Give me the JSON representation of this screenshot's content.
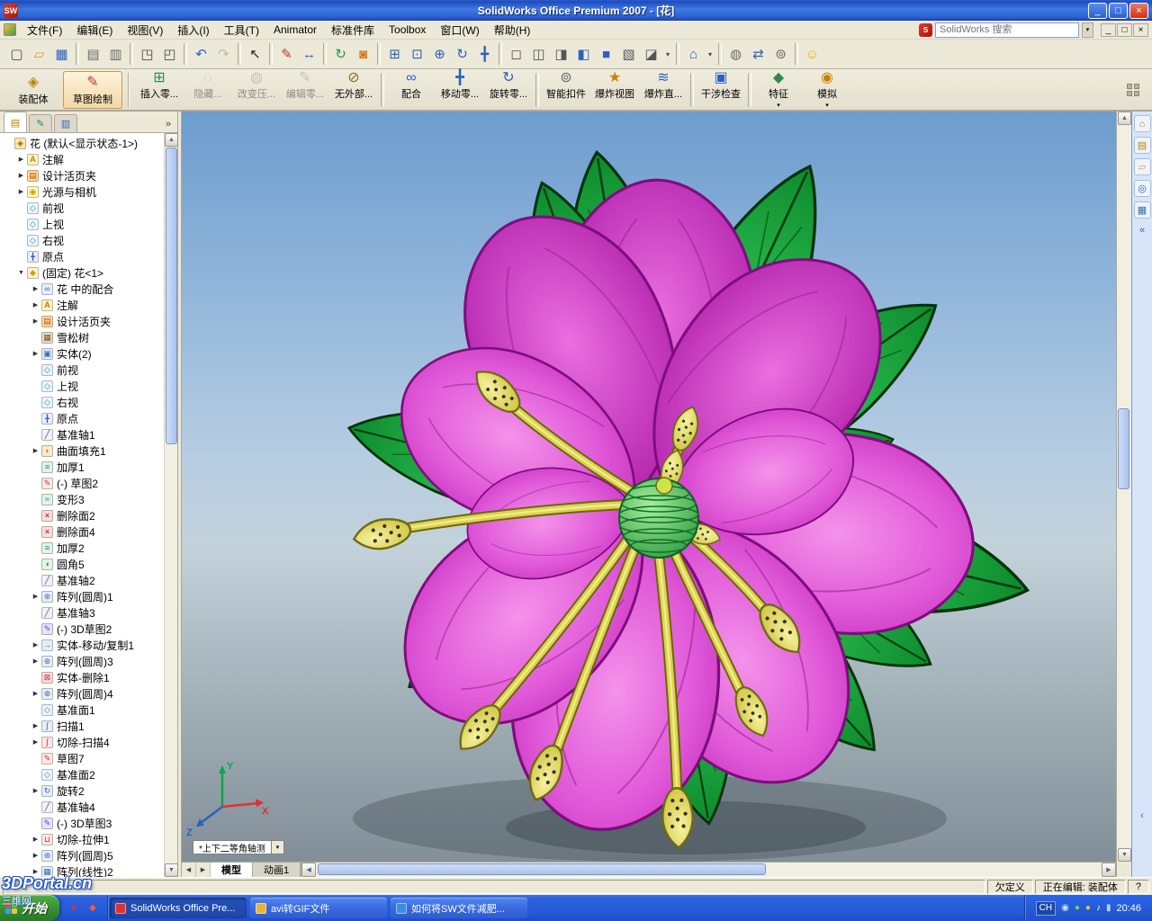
{
  "titlebar": {
    "title": "SolidWorks Office Premium 2007 - [花]",
    "buttons": {
      "minimize": "_",
      "restore": "□",
      "close": "×"
    }
  },
  "menubar": {
    "items": [
      "文件(F)",
      "编辑(E)",
      "视图(V)",
      "插入(I)",
      "工具(T)",
      "Animator",
      "标准件库",
      "Toolbox",
      "窗口(W)",
      "帮助(H)"
    ],
    "search": {
      "placeholder": "SolidWorks 搜索"
    },
    "child_buttons": {
      "minimize": "_",
      "restore": "□",
      "close": "×"
    }
  },
  "toolbar": {
    "items": [
      {
        "name": "new-document",
        "glyph": "▢",
        "color": "#4a4a4a",
        "type": "btn"
      },
      {
        "name": "open-document",
        "glyph": "▱",
        "color": "#d79b2a",
        "type": "btn"
      },
      {
        "name": "save-document",
        "glyph": "▦",
        "color": "#2a62bd",
        "type": "btn"
      },
      {
        "type": "sep",
        "inter": false
      },
      {
        "name": "make-drawing-from-part",
        "glyph": "▤",
        "color": "#6a6a6a",
        "type": "btn"
      },
      {
        "name": "make-assembly-from-part",
        "glyph": "▥",
        "color": "#6a6a6a",
        "type": "btn"
      },
      {
        "type": "sep",
        "inter": false
      },
      {
        "name": "print",
        "glyph": "◳",
        "color": "#4a4a4a",
        "type": "btn"
      },
      {
        "name": "print-preview",
        "glyph": "◰",
        "color": "#4a4a4a",
        "type": "btn"
      },
      {
        "type": "sep",
        "inter": false
      },
      {
        "name": "undo",
        "glyph": "↶",
        "color": "#2a62bd",
        "type": "btn"
      },
      {
        "name": "redo",
        "glyph": "↷",
        "color": "#777777",
        "type": "btn grayed"
      },
      {
        "type": "sep",
        "inter": false
      },
      {
        "name": "select",
        "glyph": "↖",
        "color": "#222222",
        "type": "btn"
      },
      {
        "type": "sep",
        "inter": false
      },
      {
        "name": "sketch",
        "glyph": "✎",
        "color": "#c0392b",
        "type": "btn"
      },
      {
        "name": "smart-dimension",
        "glyph": "↔",
        "color": "#2a62bd",
        "type": "btn"
      },
      {
        "type": "sep",
        "inter": false
      },
      {
        "name": "rebuild",
        "glyph": "↻",
        "color": "#2e8b57",
        "type": "btn"
      },
      {
        "name": "edit-appearance",
        "glyph": "◙",
        "color": "#d07818",
        "type": "btn"
      },
      {
        "type": "sep",
        "inter": false
      },
      {
        "name": "zoom-to-fit",
        "glyph": "⊞",
        "color": "#2a62bd",
        "type": "btn"
      },
      {
        "name": "zoom-to-area",
        "glyph": "⊡",
        "color": "#2a62bd",
        "type": "btn"
      },
      {
        "name": "zoom-in-out",
        "glyph": "⊕",
        "color": "#2a62bd",
        "type": "btn"
      },
      {
        "name": "rotate-view",
        "glyph": "↻",
        "color": "#2a62bd",
        "type": "btn"
      },
      {
        "name": "pan",
        "glyph": "╋",
        "color": "#2a62bd",
        "type": "btn"
      },
      {
        "type": "sep",
        "inter": false
      },
      {
        "name": "wireframe",
        "glyph": "◻",
        "color": "#555555",
        "type": "btn"
      },
      {
        "name": "hidden-lines-visible",
        "glyph": "◫",
        "color": "#555555",
        "type": "btn"
      },
      {
        "name": "hidden-lines-removed",
        "glyph": "◨",
        "color": "#555555",
        "type": "btn"
      },
      {
        "name": "shaded-with-edges",
        "glyph": "◧",
        "color": "#2a62bd",
        "type": "btn"
      },
      {
        "name": "shaded",
        "glyph": "■",
        "color": "#2a62bd",
        "type": "btn"
      },
      {
        "name": "shadows-in-shaded-mode",
        "glyph": "▧",
        "color": "#555555",
        "type": "btn"
      },
      {
        "name": "section-view",
        "glyph": "◪",
        "color": "#555555",
        "type": "btn"
      },
      {
        "name": "view-settings-dropdown",
        "glyph": "▾",
        "color": "#444444",
        "type": "dd"
      },
      {
        "type": "sep",
        "inter": false
      },
      {
        "name": "standard-views",
        "glyph": "⌂",
        "color": "#2a62bd",
        "type": "btn"
      },
      {
        "name": "standard-views-dropdown",
        "glyph": "▾",
        "color": "#444444",
        "type": "dd"
      },
      {
        "type": "sep",
        "inter": false
      },
      {
        "name": "hide-show-components",
        "glyph": "◍",
        "color": "#6a6a6a",
        "type": "btn"
      },
      {
        "name": "move-component-tool",
        "glyph": "⇄",
        "color": "#2a62bd",
        "type": "btn"
      },
      {
        "name": "smart-fasteners-tool",
        "glyph": "⊚",
        "color": "#6a6a6a",
        "type": "btn"
      },
      {
        "type": "sep",
        "inter": false
      },
      {
        "name": "realview-graphics",
        "glyph": "☺",
        "color": "#e8b800",
        "type": "btn"
      }
    ]
  },
  "command_manager": {
    "tabs": [
      {
        "name": "assembly",
        "label": "装配体",
        "glyph": "◈",
        "color": "#b58600",
        "state": "tab"
      },
      {
        "name": "sketch-mode",
        "label": "草图绘制",
        "glyph": "✎",
        "color": "#c0392b",
        "state": "tab active"
      }
    ],
    "buttons": [
      {
        "name": "insert-component",
        "glyph": "⊞",
        "color": "#2e8b57",
        "label": "插入零...",
        "state": "btn"
      },
      {
        "name": "hide-show-component",
        "glyph": "◌",
        "color": "#888888",
        "label": "隐藏...",
        "state": "btn grayed"
      },
      {
        "name": "change-suppression",
        "glyph": "◍",
        "color": "#888888",
        "label": "改变压...",
        "state": "btn grayed"
      },
      {
        "name": "edit-component",
        "glyph": "✎",
        "color": "#888888",
        "label": "编辑零...",
        "state": "btn grayed"
      },
      {
        "name": "no-external-references",
        "glyph": "⊘",
        "color": "#8a6d1d",
        "label": "无外部...",
        "state": "btn"
      },
      {
        "state": "sep",
        "inter": false
      },
      {
        "name": "mate",
        "glyph": "∞",
        "color": "#2a62bd",
        "label": "配合",
        "state": "btn"
      },
      {
        "name": "move-component",
        "glyph": "╋",
        "color": "#2a62bd",
        "label": "移动零...",
        "state": "btn"
      },
      {
        "name": "rotate-component",
        "glyph": "↻",
        "color": "#2a62bd",
        "label": "旋转零...",
        "state": "btn"
      },
      {
        "state": "sep",
        "inter": false
      },
      {
        "name": "smart-fasteners",
        "glyph": "⊚",
        "color": "#6a6a6a",
        "label": "智能扣件",
        "state": "btn"
      },
      {
        "name": "exploded-view",
        "glyph": "★",
        "color": "#d08000",
        "label": "爆炸视图",
        "state": "btn"
      },
      {
        "name": "explode-line-sketch",
        "glyph": "≋",
        "color": "#2a62bd",
        "label": "爆炸直...",
        "state": "btn"
      },
      {
        "state": "sep",
        "inter": false
      },
      {
        "name": "interference-detection",
        "glyph": "▣",
        "color": "#2a62bd",
        "label": "干涉检查",
        "state": "btn"
      },
      {
        "state": "sep",
        "inter": false
      },
      {
        "name": "features-flyout",
        "glyph": "◆",
        "color": "#2e8b57",
        "label": "特征",
        "state": "btn",
        "dropdown": true
      },
      {
        "name": "simulation-flyout",
        "glyph": "◉",
        "color": "#d08000",
        "label": "模拟",
        "state": "btn",
        "dropdown": true
      }
    ]
  },
  "feature_panel": {
    "tabs": [
      {
        "name": "featuremanager-tab",
        "glyph": "▤",
        "color": "#b58600",
        "state": "ptab active"
      },
      {
        "name": "propertymanager-tab",
        "glyph": "✎",
        "color": "#2e8b57",
        "state": "ptab"
      },
      {
        "name": "configurationmanager-tab",
        "glyph": "▥",
        "color": "#2a62bd",
        "state": "ptab"
      }
    ]
  },
  "feature_tree": {
    "items": [
      {
        "label": "花 (默认<显示状态-1>)",
        "icon": "assembly",
        "ind": "ind0",
        "arrow": null
      },
      {
        "label": "注解",
        "icon": "annotations",
        "ind": "ind1",
        "arrow": "right"
      },
      {
        "label": "设计活页夹",
        "icon": "design-binder",
        "ind": "ind1",
        "arrow": "right"
      },
      {
        "label": "光源与相机",
        "icon": "lights-cameras",
        "ind": "ind1",
        "arrow": "right"
      },
      {
        "label": "前视",
        "icon": "plane",
        "ind": "ind1",
        "arrow": null
      },
      {
        "label": "上视",
        "icon": "plane",
        "ind": "ind1",
        "arrow": null
      },
      {
        "label": "右视",
        "icon": "plane",
        "ind": "ind1",
        "arrow": null
      },
      {
        "label": "原点",
        "icon": "origin",
        "ind": "ind1",
        "arrow": null
      },
      {
        "label": "(固定) 花<1>",
        "icon": "part",
        "ind": "ind1",
        "arrow": "down"
      },
      {
        "label": "花 中的配合",
        "icon": "mates",
        "ind": "ind2",
        "arrow": "right"
      },
      {
        "label": "注解",
        "icon": "annotations",
        "ind": "ind2",
        "arrow": "right"
      },
      {
        "label": "设计活页夹",
        "icon": "design-binder",
        "ind": "ind2",
        "arrow": "right"
      },
      {
        "label": "雪松树",
        "icon": "material",
        "ind": "ind2",
        "arrow": null
      },
      {
        "label": "实体(2)",
        "icon": "solid-bodies",
        "ind": "ind2",
        "arrow": "right"
      },
      {
        "label": "前视",
        "icon": "plane",
        "ind": "ind2",
        "arrow": null
      },
      {
        "label": "上视",
        "icon": "plane",
        "ind": "ind2",
        "arrow": null
      },
      {
        "label": "右视",
        "icon": "plane",
        "ind": "ind2",
        "arrow": null
      },
      {
        "label": "原点",
        "icon": "origin",
        "ind": "ind2",
        "arrow": null
      },
      {
        "label": "基准轴1",
        "icon": "axis",
        "ind": "ind2",
        "arrow": null
      },
      {
        "label": "曲面填充1",
        "icon": "surface-fill",
        "ind": "ind2",
        "arrow": "right"
      },
      {
        "label": "加厚1",
        "icon": "thicken",
        "ind": "ind2",
        "arrow": null
      },
      {
        "label": "(-) 草图2",
        "icon": "sketch",
        "ind": "ind2",
        "arrow": null
      },
      {
        "label": "变形3",
        "icon": "deform",
        "ind": "ind2",
        "arrow": null
      },
      {
        "label": "删除面2",
        "icon": "delete-face",
        "ind": "ind2",
        "arrow": null
      },
      {
        "label": "删除面4",
        "icon": "delete-face",
        "ind": "ind2",
        "arrow": null
      },
      {
        "label": "加厚2",
        "icon": "thicken",
        "ind": "ind2",
        "arrow": null
      },
      {
        "label": "圆角5",
        "icon": "fillet",
        "ind": "ind2",
        "arrow": null
      },
      {
        "label": "基准轴2",
        "icon": "axis",
        "ind": "ind2",
        "arrow": null
      },
      {
        "label": "阵列(圆周)1",
        "icon": "circular-pattern",
        "ind": "ind2",
        "arrow": "right"
      },
      {
        "label": "基准轴3",
        "icon": "axis",
        "ind": "ind2",
        "arrow": null
      },
      {
        "label": "(-) 3D草图2",
        "icon": "sketch3d",
        "ind": "ind2",
        "arrow": null
      },
      {
        "label": "实体-移动/复制1",
        "icon": "body-move",
        "ind": "ind2",
        "arrow": "right"
      },
      {
        "label": "阵列(圆周)3",
        "icon": "circular-pattern",
        "ind": "ind2",
        "arrow": "right"
      },
      {
        "label": "实体-删除1",
        "icon": "body-delete",
        "ind": "ind2",
        "arrow": null
      },
      {
        "label": "阵列(圆周)4",
        "icon": "circular-pattern",
        "ind": "ind2",
        "arrow": "right"
      },
      {
        "label": "基准面1",
        "icon": "plane",
        "ind": "ind2",
        "arrow": null
      },
      {
        "label": "扫描1",
        "icon": "sweep",
        "ind": "ind2",
        "arrow": "right"
      },
      {
        "label": "切除-扫描4",
        "icon": "cut-sweep",
        "ind": "ind2",
        "arrow": "right"
      },
      {
        "label": "草图7",
        "icon": "sketch",
        "ind": "ind2",
        "arrow": null
      },
      {
        "label": "基准面2",
        "icon": "plane",
        "ind": "ind2",
        "arrow": null
      },
      {
        "label": "旋转2",
        "icon": "revolve",
        "ind": "ind2",
        "arrow": "right"
      },
      {
        "label": "基准轴4",
        "icon": "axis",
        "ind": "ind2",
        "arrow": null
      },
      {
        "label": "(-) 3D草图3",
        "icon": "sketch3d",
        "ind": "ind2",
        "arrow": null
      },
      {
        "label": "切除-拉伸1",
        "icon": "cut-extrude",
        "ind": "ind2",
        "arrow": "right"
      },
      {
        "label": "阵列(圆周)5",
        "icon": "circular-pattern",
        "ind": "ind2",
        "arrow": "right"
      },
      {
        "label": "阵列(线性)2",
        "icon": "linear-pattern",
        "ind": "ind2",
        "arrow": "right"
      }
    ]
  },
  "viewport": {
    "view_label": "*上下二等角轴测",
    "model_tabs": [
      {
        "label": "模型",
        "state": "active"
      },
      {
        "label": "动画1",
        "state": ""
      }
    ],
    "triad": {
      "x": "X",
      "y": "Y",
      "z": "Z"
    }
  },
  "task_pane": {
    "icons": [
      {
        "name": "solidworks-resources",
        "glyph": "⌂",
        "color": "#d07818"
      },
      {
        "name": "design-library",
        "glyph": "▤",
        "color": "#b58600"
      },
      {
        "name": "file-explorer",
        "glyph": "▱",
        "color": "#d79b2a"
      },
      {
        "name": "solidworks-search",
        "glyph": "◎",
        "color": "#2a62bd"
      },
      {
        "name": "view-palette",
        "glyph": "▦",
        "color": "#3a6ea5"
      }
    ]
  },
  "statusbar": {
    "status": "欠定义",
    "editing": "正在编辑: 装配体",
    "help": "?"
  },
  "taskbar": {
    "start_label": "开始",
    "quicklaunch": [
      {
        "name": "quicklaunch-player",
        "glyph": "●",
        "color": "#e03131"
      },
      {
        "name": "quicklaunch-solidworks",
        "glyph": "◆",
        "color": "#ff5540"
      }
    ],
    "tasks": [
      {
        "label": "SolidWorks Office Pre...",
        "icon_color": "#e03131",
        "state": "active"
      },
      {
        "label": "avi转GIF文件",
        "icon_color": "#e8b33d",
        "state": ""
      },
      {
        "label": "如何将SW文件减肥...",
        "icon_color": "#3a8ee0",
        "state": ""
      }
    ],
    "tray": {
      "lang": "CH",
      "icons": [
        {
          "name": "tray-app",
          "glyph": "◉",
          "color": "#cfe4ff"
        },
        {
          "name": "tray-antivirus",
          "glyph": "●",
          "color": "#7fd24a"
        },
        {
          "name": "tray-safety",
          "glyph": "●",
          "color": "#f0c040"
        },
        {
          "name": "tray-volume",
          "glyph": "♪",
          "color": "#ffffff"
        },
        {
          "name": "tray-network",
          "glyph": "▮",
          "color": "#bcd6ff"
        }
      ],
      "time": "20:46"
    }
  },
  "watermark": {
    "line1": "3DPortal.cn",
    "line2": "三维网"
  },
  "colors": {
    "petal": "#d944d0",
    "leaf": "#1faf3c",
    "stamen": "#ddd34a",
    "sky_top": "#6d9cce",
    "sky_bottom": "#828f98"
  }
}
